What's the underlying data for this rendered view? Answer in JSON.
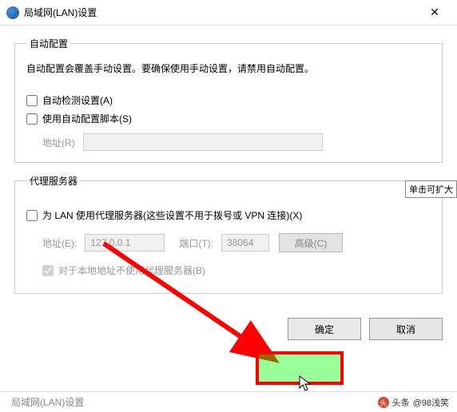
{
  "window": {
    "title": "局域网(LAN)设置",
    "close_glyph": "✕"
  },
  "tooltip": "单击可扩大",
  "auto_config": {
    "legend": "自动配置",
    "note": "自动配置会覆盖手动设置。要确保使用手动设置，请禁用自动配置。",
    "detect_label": "自动检测设置(A)",
    "script_label": "使用自动配置脚本(S)",
    "addr_label": "地址(R)",
    "addr_value": ""
  },
  "proxy": {
    "legend": "代理服务器",
    "use_proxy_label": "为 LAN 使用代理服务器(这些设置不用于拨号或 VPN 连接)(X)",
    "addr_label": "地址(E):",
    "addr_value": "127.0.0.1",
    "port_label": "端口(T):",
    "port_value": "38064",
    "advanced_label": "高级(C)",
    "bypass_local_label": "对于本地地址不使用代理服务器(B)"
  },
  "buttons": {
    "ok": "确定",
    "cancel": "取消"
  },
  "footer": {
    "truncated": "局域网(LAN)设置",
    "credit_source": "头条",
    "credit_user": "@98浅笑"
  }
}
